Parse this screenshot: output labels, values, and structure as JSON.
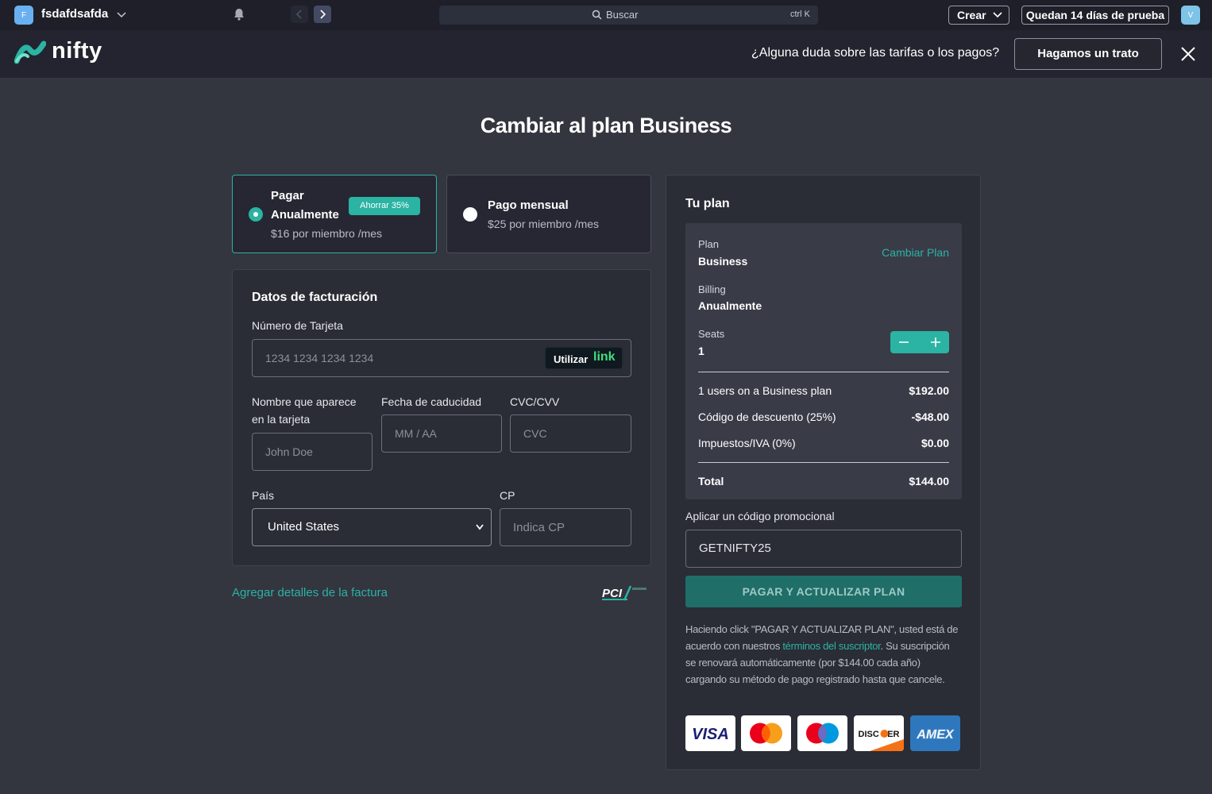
{
  "topbar": {
    "workspace_initial": "F",
    "workspace_name": "fsdafdsafda",
    "search_label": "Buscar",
    "search_shortcut": "ctrl K",
    "create_label": "Crear",
    "trial_label": "Quedan 14 días de prueba",
    "user_initial": "V"
  },
  "header": {
    "logo_text": "nifty",
    "question": "¿Alguna duda sobre las tarifas o los pagos?",
    "deal_button": "Hagamos un trato"
  },
  "page_title": "Cambiar al plan Business",
  "billing_options": {
    "annual": {
      "title_line1": "Pagar",
      "title_line2": "Anualmente",
      "badge": "Ahorrar 35%",
      "price": "$16 por miembro /mes",
      "selected": true
    },
    "monthly": {
      "title": "Pago mensual",
      "price": "$25 por miembro /mes",
      "selected": false
    }
  },
  "billing_form": {
    "title": "Datos de facturación",
    "card_number_label": "Número de Tarjeta",
    "card_number_placeholder": "1234 1234 1234 1234",
    "link_button_part1": "Utilizar",
    "link_button_part2": "link",
    "name_label_line1": "Nombre que aparece",
    "name_label_line2": "en la tarjeta",
    "name_placeholder": "John Doe",
    "expiry_label": "Fecha de caducidad",
    "expiry_placeholder": "MM / AA",
    "cvc_label": "CVC/CVV",
    "cvc_placeholder": "CVC",
    "country_label": "País",
    "country_value": "United States",
    "zip_label": "CP",
    "zip_placeholder": "Indica CP"
  },
  "add_invoice_link": "Agregar detalles de la factura",
  "pci_text": "PCI",
  "plan": {
    "title": "Tu plan",
    "plan_label": "Plan",
    "plan_value": "Business",
    "change_plan": "Cambiar Plan",
    "billing_label": "Billing",
    "billing_value": "Anualmente",
    "seats_label": "Seats",
    "seats_value": "1",
    "lines": [
      {
        "name": "1 users on a Business plan",
        "amount": "$192.00"
      },
      {
        "name": "Código de descuento (25%)",
        "amount": "-$48.00"
      },
      {
        "name": "Impuestos/IVA (0%)",
        "amount": "$0.00"
      }
    ],
    "total_label": "Total",
    "total_value": "$144.00",
    "promo_label": "Aplicar un código promocional",
    "promo_value": "GETNIFTY25",
    "pay_button": "PAGAR Y ACTUALIZAR PLAN",
    "terms_before": "Haciendo click \"PAGAR Y ACTUALIZAR PLAN\", usted está de acuerdo con nuestros ",
    "terms_link": "términos del suscriptor",
    "terms_after": ". Su suscripción se renovará automáticamente (por $144.00 cada año) cargando su método de pago registrado hasta que cancele."
  },
  "payment_cards": {
    "visa": "VISA",
    "discover": "DISC VER",
    "amex": "AMEX"
  },
  "colors": {
    "accent": "#2bb3a3",
    "background": "#33353f",
    "card": "#2a2c36"
  }
}
